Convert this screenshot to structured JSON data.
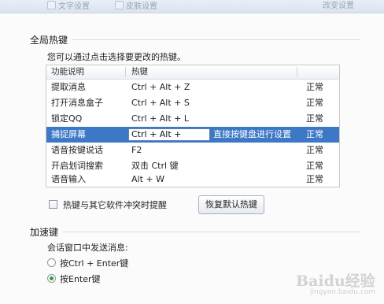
{
  "top_tabs": [
    "文字设置",
    "皮肤设置",
    "改变设置"
  ],
  "global_hotkeys": {
    "title": "全局热键",
    "instruction": "您可以通过点击选择要更改的热键。",
    "columns": {
      "function": "功能说明",
      "hotkey": "热键"
    },
    "rows": [
      {
        "function": "提取消息",
        "hotkey": "Ctrl + Alt + Z",
        "hint": "",
        "status": "正常"
      },
      {
        "function": "打开消息盒子",
        "hotkey": "Ctrl + Alt + S",
        "hint": "",
        "status": "正常"
      },
      {
        "function": "锁定QQ",
        "hotkey": "Ctrl + Alt + L",
        "hint": "",
        "status": "正常"
      },
      {
        "function": "捕捉屏幕",
        "hotkey": "Ctrl + Alt +",
        "hint": "直接按键盘进行设置",
        "status": "正常"
      },
      {
        "function": "语音按键说话",
        "hotkey": "F2",
        "hint": "",
        "status": "正常"
      },
      {
        "function": "开启划词搜索",
        "hotkey": "双击 Ctrl 键",
        "hint": "",
        "status": "正常"
      },
      {
        "function": "语音输入",
        "hotkey": "Alt + W",
        "hint": "",
        "status": "正常"
      }
    ],
    "conflict_checkbox_label": "热键与其它软件冲突时提醒",
    "conflict_checked": false,
    "restore_button": "恢复默认热键"
  },
  "accelerator": {
    "title": "加速键",
    "send_label": "会话窗口中发送消息:",
    "options": [
      {
        "label": "按Ctrl + Enter键",
        "selected": false
      },
      {
        "label": "按Enter键",
        "selected": true
      }
    ]
  },
  "watermark": {
    "text": "Baidu经验",
    "sub": "jingyan.baidu.com"
  },
  "colors": {
    "selection": "#3c78c6",
    "radio_dot": "#2f9a3d"
  }
}
